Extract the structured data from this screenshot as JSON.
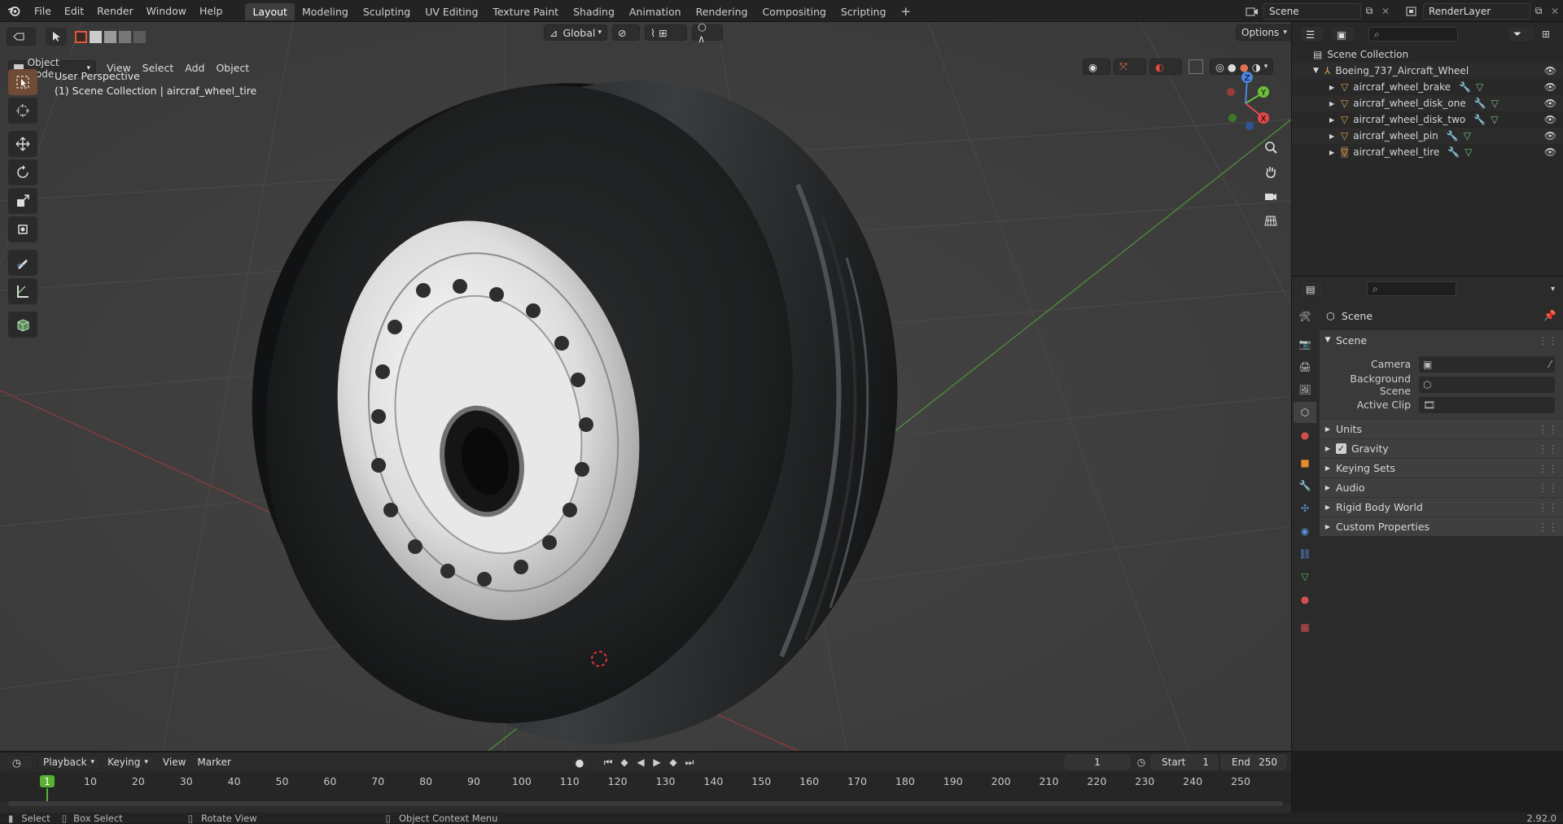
{
  "topbar": {
    "menus": [
      "File",
      "Edit",
      "Render",
      "Window",
      "Help"
    ],
    "workspaces": [
      "Layout",
      "Modeling",
      "Sculpting",
      "UV Editing",
      "Texture Paint",
      "Shading",
      "Animation",
      "Rendering",
      "Compositing",
      "Scripting"
    ],
    "active_workspace": "Layout",
    "scene_name": "Scene",
    "view_layer": "RenderLayer"
  },
  "viewport": {
    "mode": "Object Mode",
    "menus": [
      "View",
      "Select",
      "Add",
      "Object"
    ],
    "transform_orientation": "Global",
    "options_label": "Options",
    "perspective_label": "User Perspective",
    "collection_label": "(1) Scene Collection | aircraf_wheel_tire",
    "gizmo_axes": [
      "X",
      "Y",
      "Z"
    ]
  },
  "outliner": {
    "root": "Scene Collection",
    "collection": "Boeing_737_Aircraft_Wheel",
    "objects": [
      "aircraf_wheel_brake",
      "aircraf_wheel_disk_one",
      "aircraf_wheel_disk_two",
      "aircraf_wheel_pin",
      "aircraf_wheel_tire"
    ]
  },
  "properties": {
    "context_title": "Scene",
    "panel_title": "Scene",
    "fields": [
      {
        "label": "Camera"
      },
      {
        "label": "Background Scene"
      },
      {
        "label": "Active Clip"
      }
    ],
    "subpanels": [
      "Units",
      "Gravity",
      "Keying Sets",
      "Audio",
      "Rigid Body World",
      "Custom Properties"
    ],
    "gravity_checked": true
  },
  "timeline": {
    "menus": [
      "Playback",
      "Keying",
      "View",
      "Marker"
    ],
    "current_frame": "1",
    "start_label": "Start",
    "start_value": "1",
    "end_label": "End",
    "end_value": "250",
    "ticks": [
      "1",
      "10",
      "20",
      "30",
      "40",
      "50",
      "60",
      "70",
      "80",
      "90",
      "100",
      "110",
      "120",
      "130",
      "140",
      "150",
      "160",
      "170",
      "180",
      "190",
      "200",
      "210",
      "220",
      "230",
      "240",
      "250"
    ]
  },
  "statusbar": {
    "select": "Select",
    "box_select": "Box Select",
    "rotate_view": "Rotate View",
    "context_menu": "Object Context Menu",
    "version": "2.92.0"
  },
  "colors": {
    "accent": "#4772b3",
    "active_tool": "#6f4a34",
    "x_axis": "#b73a3a",
    "y_axis": "#5b9a3a",
    "frame_marker": "#5ab030"
  }
}
